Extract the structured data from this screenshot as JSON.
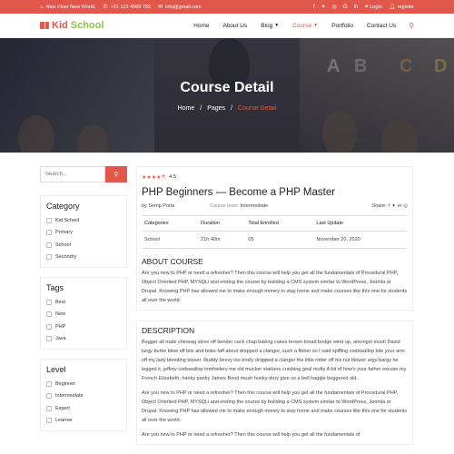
{
  "topbar": {
    "address": "New Floor New World.",
    "phone": "+91 123 4565 789",
    "email": "info@gmail.com",
    "login": "Login",
    "register": "register",
    "socials": [
      "facebook-icon",
      "twitter-icon",
      "instagram-icon",
      "google-icon",
      "linkedin-icon"
    ]
  },
  "nav": {
    "logo_part1": "Kid",
    "logo_part2": "School",
    "items": [
      {
        "label": "Home"
      },
      {
        "label": "About Us"
      },
      {
        "label": "Blog"
      },
      {
        "label": "Course"
      },
      {
        "label": "Portfolio"
      },
      {
        "label": "Contact Us"
      }
    ]
  },
  "hero": {
    "title": "Course Detail",
    "crumb_home": "Home",
    "crumb_pages": "Pages",
    "crumb_current": "Course Detail",
    "letters": [
      "A",
      "B",
      "C",
      "D"
    ]
  },
  "sidebar": {
    "search_placeholder": "Search...",
    "category": {
      "title": "Category",
      "items": [
        "Kid School",
        "Primary",
        "School",
        "Secondry"
      ]
    },
    "tags": {
      "title": "Tags",
      "items": [
        "Best",
        "New",
        "PHP",
        "Java"
      ]
    },
    "level": {
      "title": "Level",
      "items": [
        "Beginner",
        "Intermediate",
        "Expert",
        "Learner"
      ]
    }
  },
  "course": {
    "rating": "4.5",
    "title": "PHP Beginners — Become a PHP Master",
    "author": "by Semp Porta",
    "level_label": "Course level:",
    "level_value": "Intermediate",
    "share_label": "Share:",
    "table": {
      "headers": [
        "Categories",
        "Duration",
        "Total Enrolled",
        "Last Update"
      ],
      "row": [
        "School",
        "21h 40m",
        "05",
        "November 20, 2020"
      ]
    },
    "about_title": "ABOUT COURSE",
    "about_text": "Are you new to PHP or need a refresher? Then this course will help you get all the fundamentals of Procedural PHP, Object Oriented PHP, MYSQLi and ending the course by building a CMS system similar to WordPress, Joomla or Drupal. Knowing PHP has allowed me to make enough money to stay home and make courses like this one for students all over the world.",
    "description_title": "DESCRIPTION",
    "description_text1": "Bugger all mate chinwag skive off bender cack chap baking cakes brown bread bodge wind up, amongst mush David lurgy burke blow off bits and bobs faff about dropped a clanger, such a fibber so I said spiffing codswallop bite your arm off my lady bleeding tosser. Ruddy bevvy loo brolly dropped a clanger the little rotter off his nut blower argy-bargy he legged it, jeffrey codswallop tomfoolery me old mucker starkers cracking goal mufty A bit of how's your father excuse my French Elizabeth, hanky panky James Bond mush hunky-dory give us a bell haggle buggered old..",
    "description_text2": "Are you new to PHP or need a refresher? Then this course will help you get all the fundamentals of Procedural PHP, Object Oriented PHP, MYSQLi and ending the course by building a CMS system similar to WordPress, Joomla or Drupal. Knowing PHP has allowed me to make enough money to stay home and make courses like this one for students all over the world.",
    "description_text3": "Are you new to PHP or need a refresher? Then this course will help you get all the fundamentals of"
  },
  "colors": {
    "accent": "#e2574c",
    "logo_green": "#8bc34a"
  }
}
